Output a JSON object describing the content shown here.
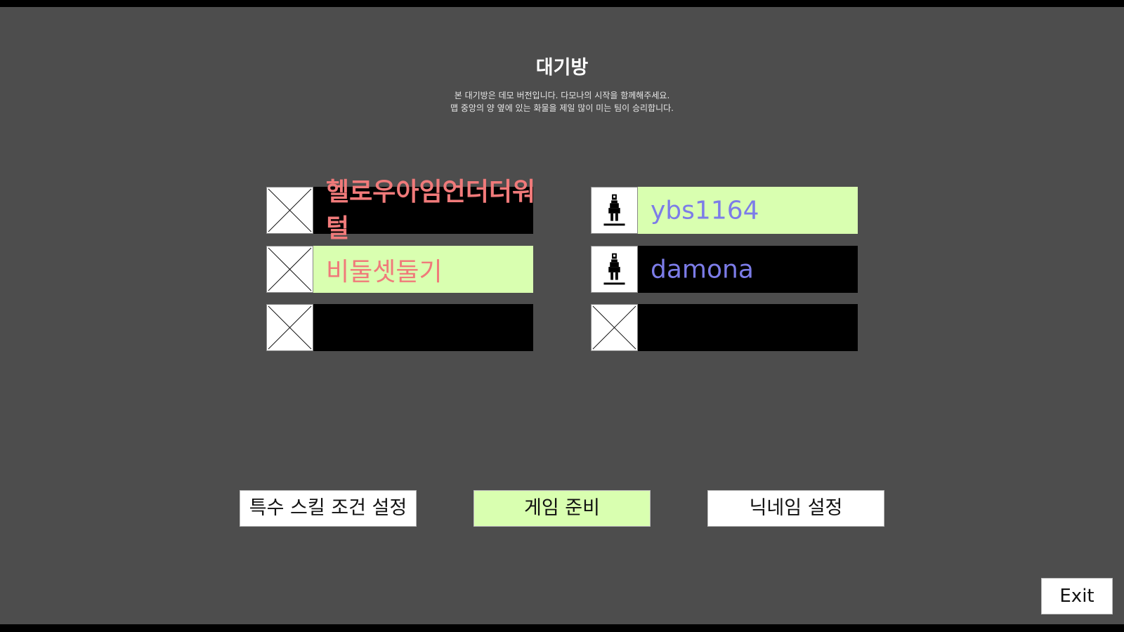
{
  "header": {
    "title": "대기방",
    "description_line1": "본 대기방은 데모 버전입니다. 다모나의 시작을 함께해주세요.",
    "description_line2": "맵 중앙의 양 옆에 있는 화물을 제일 많이 미는 팀이 승리합니다."
  },
  "teams": {
    "left": {
      "color": "#f07a7a",
      "slots": [
        {
          "name": "헬로우아임언더더워털",
          "icon": "empty-x-icon",
          "ready": false
        },
        {
          "name": "비둘셋둘기",
          "icon": "empty-x-icon",
          "ready": true
        },
        {
          "name": "",
          "icon": "empty-x-icon",
          "ready": false
        }
      ]
    },
    "right": {
      "color": "#7c7ce8",
      "slots": [
        {
          "name": "ybs1164",
          "icon": "character-icon",
          "ready": true
        },
        {
          "name": "damona",
          "icon": "character-icon",
          "ready": false
        },
        {
          "name": "",
          "icon": "empty-x-icon",
          "ready": false
        }
      ]
    }
  },
  "buttons": {
    "skill_settings": "특수 스킬 조건 설정",
    "game_ready": "게임 준비",
    "nickname_settings": "닉네임 설정",
    "exit": "Exit"
  },
  "colors": {
    "background": "#4d4d4d",
    "ready_highlight": "#d9ffb0"
  }
}
